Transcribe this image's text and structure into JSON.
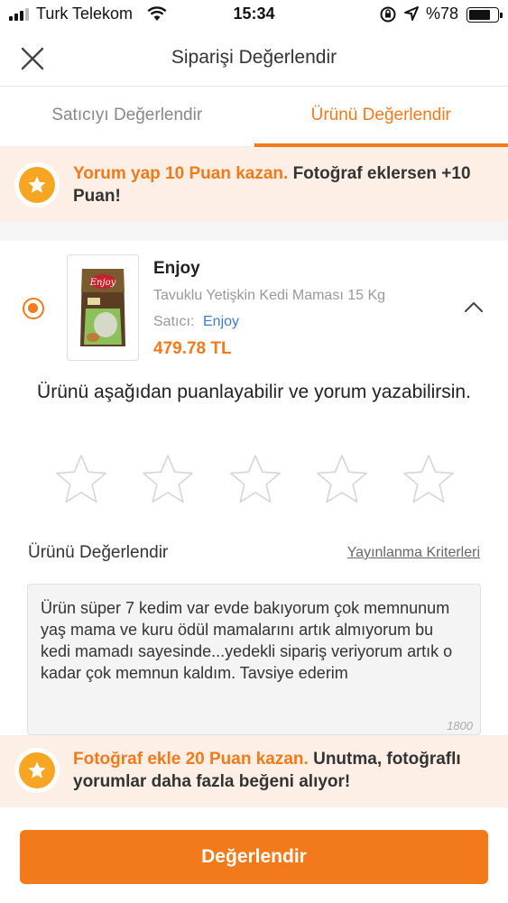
{
  "status_bar": {
    "carrier": "Turk Telekom",
    "time": "15:34",
    "battery": "%78",
    "battery_level": 0.78
  },
  "header": {
    "title": "Siparişi Değerlendir"
  },
  "tabs": [
    {
      "label": "Satıcıyı Değerlendir",
      "active": false
    },
    {
      "label": "Ürünü Değerlendir",
      "active": true
    }
  ],
  "promo_top": {
    "highlight": "Yorum yap 10 Puan kazan.",
    "text": " Fotoğraf eklersen +10 Puan!"
  },
  "product": {
    "brand": "Enjoy",
    "name": "Tavuklu Yetişkin Kedi Maması 15 Kg",
    "seller_label": "Satıcı:",
    "seller": "Enjoy",
    "price": "479.78 TL",
    "selected": true
  },
  "instruction": "Ürünü aşağıdan puanlayabilir ve yorum yazabilirsin.",
  "rating": {
    "value": 0,
    "max": 5
  },
  "review": {
    "section_label": "Ürünü Değerlendir",
    "criteria_link": "Yayınlanma Kriterleri",
    "text": "Ürün süper 7 kedim var evde bakıyorum çok memnunum yaş mama ve kuru ödül mamalarını artık almıyorum bu kedi mamadı sayesinde...yedekli sipariş veriyorum artık o kadar çok memnun kaldım. Tavsiye ederim",
    "counter": "1800"
  },
  "promo_bottom": {
    "highlight": "Fotoğraf ekle 20 Puan kazan.",
    "text": " Unutma, fotoğraflı yorumlar daha fazla beğeni alıyor!"
  },
  "footer": {
    "submit_label": "Değerlendir"
  },
  "colors": {
    "accent": "#f27a1a",
    "promo_bg": "#fdefe5",
    "link": "#3d7cc9",
    "badge": "#f6a623"
  }
}
